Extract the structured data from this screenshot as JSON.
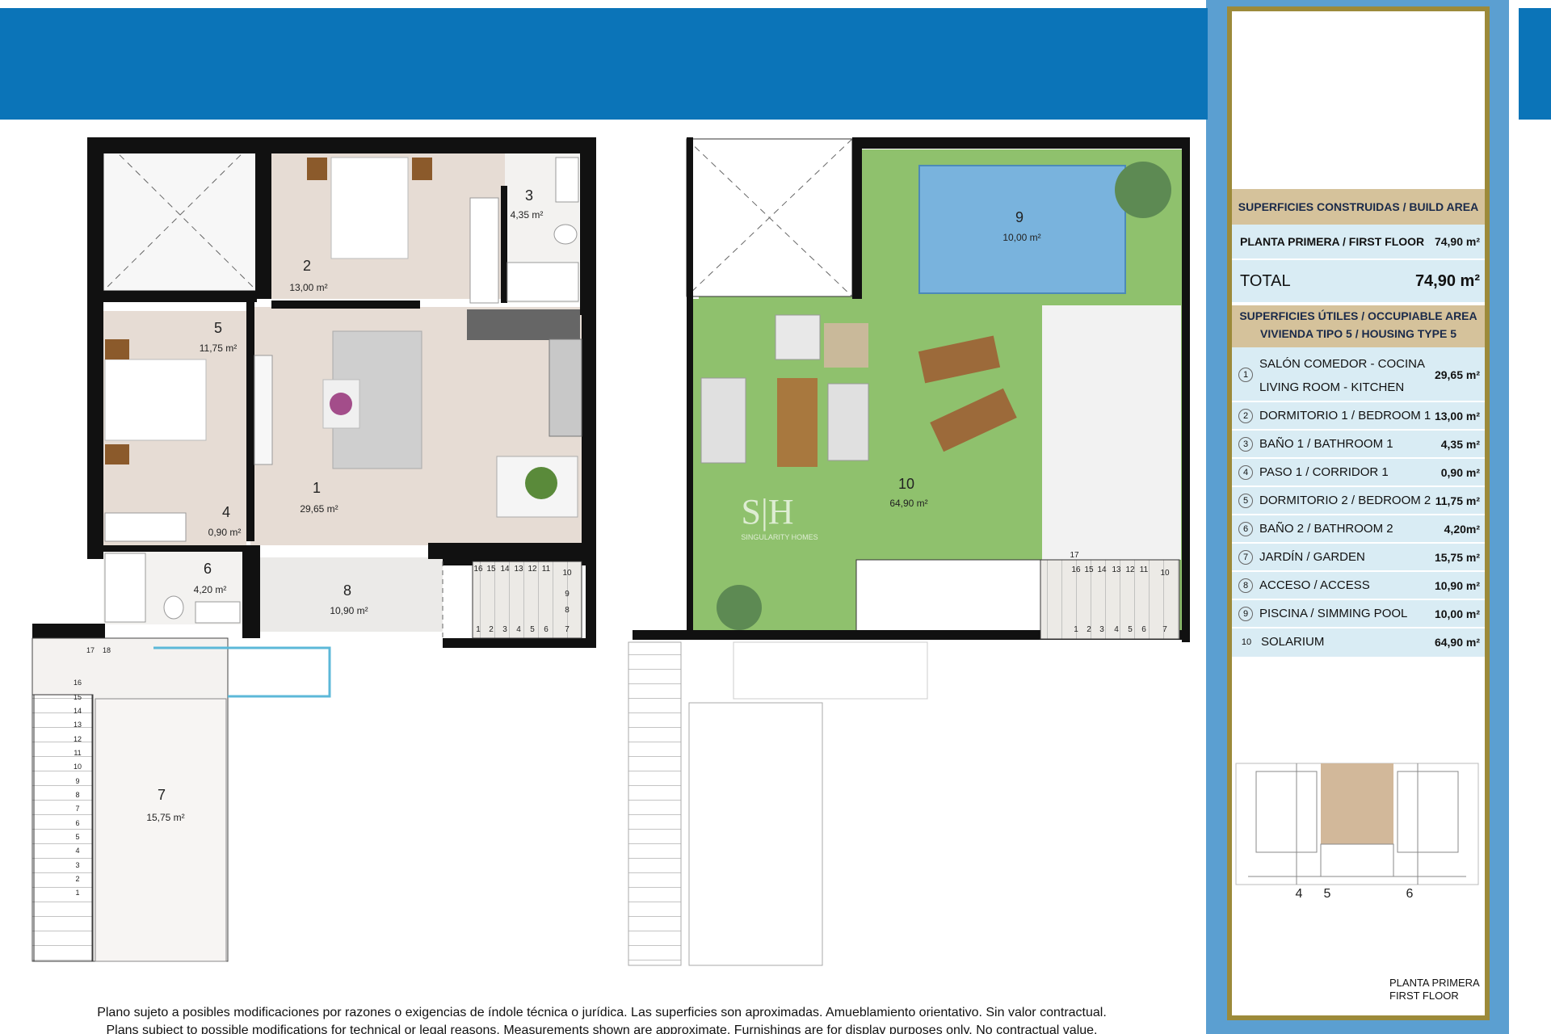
{
  "brand": {
    "watermark": "S|H",
    "watermark_sub": "SINGULARITY HOMES"
  },
  "colors": {
    "band": "#0b74b8",
    "sidebar": "#5b9fd1",
    "gold": "#9c8a3a",
    "header_bg": "#d5c29b",
    "row_bg": "#d9ecf4",
    "grass": "#8fc16d",
    "pool": "#79b3dd",
    "floor": "#e6dcd4"
  },
  "rooms": [
    {
      "n": "1",
      "area": "29,65 m²"
    },
    {
      "n": "2",
      "area": "13,00 m²"
    },
    {
      "n": "3",
      "area": "4,35 m²"
    },
    {
      "n": "4",
      "area": "0,90 m²"
    },
    {
      "n": "5",
      "area": "11,75 m²"
    },
    {
      "n": "6",
      "area": "4,20 m²"
    },
    {
      "n": "7",
      "area": "15,75 m²"
    },
    {
      "n": "8",
      "area": "10,90 m²"
    },
    {
      "n": "9",
      "area": "10,00 m²"
    },
    {
      "n": "10",
      "area": "64,90 m²"
    }
  ],
  "stairs": {
    "top": [
      "16",
      "15",
      "14",
      "13",
      "12",
      "11",
      "10"
    ],
    "side": [
      "9",
      "8"
    ],
    "bottom": [
      "1",
      "2",
      "3",
      "4",
      "5",
      "6",
      "7"
    ],
    "top_right": [
      "17",
      "16",
      "15",
      "14",
      "13",
      "12",
      "11",
      "10"
    ],
    "long": [
      "16",
      "15",
      "14",
      "13",
      "12",
      "11",
      "10",
      "9",
      "8",
      "7",
      "6",
      "5",
      "4",
      "3",
      "2",
      "1"
    ],
    "small": [
      "17",
      "18"
    ]
  },
  "build_area": {
    "title": "SUPERFICIES CONSTRUIDAS / BUILD AREA",
    "rows": [
      {
        "label": "PLANTA PRIMERA / FIRST FLOOR",
        "value": "74,90 m²"
      }
    ],
    "total_label": "TOTAL",
    "total_value": "74,90 m²"
  },
  "useful_area": {
    "title1": "SUPERFICIES ÚTILES / OCCUPIABLE AREA",
    "title2": "VIVIENDA TIPO 5 / HOUSING TYPE 5",
    "rows": [
      {
        "n": "1",
        "label": "SALÓN COMEDOR - COCINA",
        "label2": "LIVING ROOM - KITCHEN",
        "value": "29,65 m²"
      },
      {
        "n": "2",
        "label": "DORMITORIO 1 / BEDROOM 1",
        "value": "13,00 m²"
      },
      {
        "n": "3",
        "label": "BAÑO 1 / BATHROOM 1",
        "value": "4,35 m²"
      },
      {
        "n": "4",
        "label": "PASO 1 / CORRIDOR 1",
        "value": "0,90 m²"
      },
      {
        "n": "5",
        "label": "DORMITORIO 2 / BEDROOM 2",
        "value": "11,75 m²"
      },
      {
        "n": "6",
        "label": "BAÑO 2 / BATHROOM 2",
        "value": "4,20m²"
      },
      {
        "n": "7",
        "label": "JARDÍN / GARDEN",
        "value": "15,75 m²"
      },
      {
        "n": "8",
        "label": "ACCESO / ACCESS",
        "value": "10,90 m²"
      },
      {
        "n": "9",
        "label": "PISCINA / SIMMING POOL",
        "value": "10,00 m²"
      },
      {
        "n": "10",
        "label": "SOLARIUM",
        "value": "64,90 m²"
      }
    ]
  },
  "key_plan": {
    "labels": [
      "4",
      "5",
      "6"
    ],
    "caption1": "PLANTA PRIMERA",
    "caption2": "FIRST FLOOR"
  },
  "disclaimer": {
    "es": "Plano sujeto a posibles modificaciones por razones o exigencias de índole técnica o jurídica. Las superficies son aproximadas. Amueblamiento orientativo. Sin valor contractual.",
    "en": "Plans subject to possible modifications for technical or legal reasons. Measurements shown are approximate. Furnishings are for display purposes only. No contractual value."
  }
}
